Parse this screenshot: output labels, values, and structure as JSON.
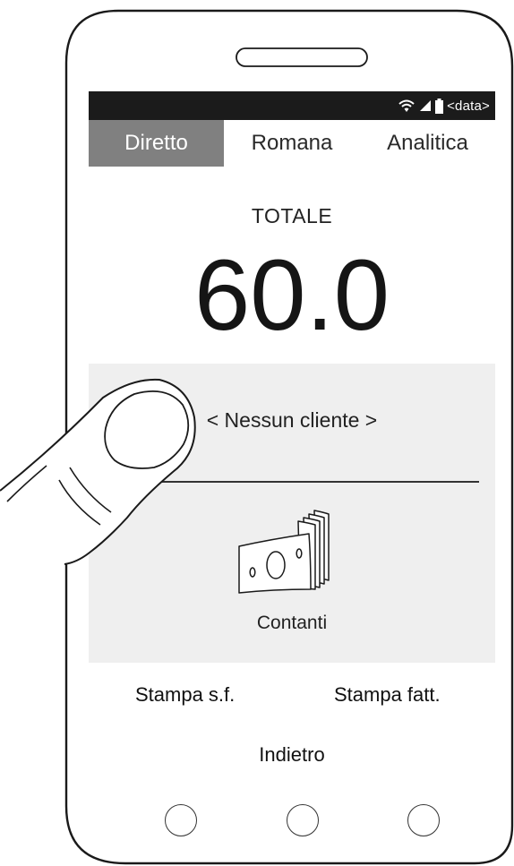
{
  "status_bar": {
    "text": "<data>"
  },
  "tabs": [
    {
      "label": "Diretto",
      "active": true
    },
    {
      "label": "Romana",
      "active": false
    },
    {
      "label": "Analitica",
      "active": false
    }
  ],
  "total": {
    "label": "TOTALE",
    "value": "60.0"
  },
  "customer": {
    "label": "< Nessun cliente >"
  },
  "payment": {
    "label": "Contanti",
    "icon": "cash-icon"
  },
  "actions": {
    "print_sf": "Stampa s.f.",
    "print_invoice": "Stampa fatt.",
    "back": "Indietro"
  },
  "navbar": {
    "buttons": [
      "back-nav-icon",
      "home-nav-icon",
      "recents-nav-icon"
    ]
  },
  "colors": {
    "status_bar": "#1b1b1b",
    "active_tab": "#808080",
    "panel": "#efefef"
  }
}
